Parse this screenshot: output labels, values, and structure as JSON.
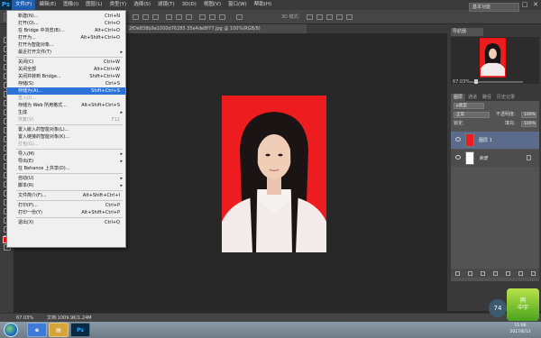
{
  "app": {
    "logo": "Ps"
  },
  "menubar": {
    "items": [
      "文件(F)",
      "编辑(E)",
      "图像(I)",
      "图层(L)",
      "类型(Y)",
      "选择(S)",
      "滤镜(T)",
      "3D(D)",
      "视图(V)",
      "窗口(W)",
      "帮助(H)"
    ],
    "active_index": 0
  },
  "window_controls": {
    "minimize": "–",
    "maximize": "□",
    "close": "✕"
  },
  "options_bar": {
    "label_3d": "3D 模式:",
    "workspace": "基本功能"
  },
  "document_tab": {
    "title": "2fDe838b9a1000d76285 35e4de8f77.jpg @ 100%(RGB/8)"
  },
  "file_menu": [
    {
      "label": "新建(N)...",
      "shortcut": "Ctrl+N"
    },
    {
      "label": "打开(O)...",
      "shortcut": "Ctrl+O"
    },
    {
      "label": "在 Bridge 中浏览(B)...",
      "shortcut": "Alt+Ctrl+O"
    },
    {
      "label": "打开为...",
      "shortcut": "Alt+Shift+Ctrl+O"
    },
    {
      "label": "打开为智能对象...",
      "shortcut": ""
    },
    {
      "label": "最近打开文件(T)",
      "shortcut": "",
      "submenu": true
    },
    {
      "sep": true
    },
    {
      "label": "关闭(C)",
      "shortcut": "Ctrl+W"
    },
    {
      "label": "关闭全部",
      "shortcut": "Alt+Ctrl+W"
    },
    {
      "label": "关闭并转到 Bridge...",
      "shortcut": "Shift+Ctrl+W"
    },
    {
      "label": "存储(S)",
      "shortcut": "Ctrl+S"
    },
    {
      "label": "存储为(A)...",
      "shortcut": "Shift+Ctrl+S",
      "highlight": true
    },
    {
      "label": "签入(I)...",
      "shortcut": "",
      "disabled": true
    },
    {
      "label": "存储为 Web 所用格式...",
      "shortcut": "Alt+Shift+Ctrl+S"
    },
    {
      "label": "生成",
      "shortcut": "",
      "submenu": true
    },
    {
      "label": "恢复(V)",
      "shortcut": "F12",
      "disabled": true
    },
    {
      "sep": true
    },
    {
      "label": "置入嵌入的智能对象(L)...",
      "shortcut": ""
    },
    {
      "label": "置入链接的智能对象(K)...",
      "shortcut": ""
    },
    {
      "label": "打包(G)...",
      "shortcut": "",
      "disabled": true
    },
    {
      "sep": true
    },
    {
      "label": "导入(M)",
      "shortcut": "",
      "submenu": true
    },
    {
      "label": "导出(E)",
      "shortcut": "",
      "submenu": true
    },
    {
      "label": "在 Behance 上共享(D)...",
      "shortcut": ""
    },
    {
      "sep": true
    },
    {
      "label": "自动(U)",
      "shortcut": "",
      "submenu": true
    },
    {
      "label": "脚本(R)",
      "shortcut": "",
      "submenu": true
    },
    {
      "sep": true
    },
    {
      "label": "文件简介(F)...",
      "shortcut": "Alt+Shift+Ctrl+I"
    },
    {
      "sep": true
    },
    {
      "label": "打印(P)...",
      "shortcut": "Ctrl+P"
    },
    {
      "label": "打印一份(Y)",
      "shortcut": "Alt+Shift+Ctrl+P"
    },
    {
      "sep": true
    },
    {
      "label": "退出(X)",
      "shortcut": "Ctrl+Q"
    }
  ],
  "navigator": {
    "tab": "导航器",
    "zoom": "67.03%"
  },
  "layers_panel": {
    "tabs": [
      "图层",
      "通道",
      "路径",
      "历史记录"
    ],
    "kind_filter": "ρ类型",
    "blend_mode": "正常",
    "opacity_label": "不透明度:",
    "opacity_value": "100%",
    "lock_label": "锁定:",
    "fill_label": "填充:",
    "fill_value": "100%",
    "layers": [
      {
        "name": "图层 1",
        "selected": true
      },
      {
        "name": "背景",
        "locked": true
      }
    ]
  },
  "status": {
    "zoom": "67.03%",
    "doc": "文档:1009.9K/1.24M"
  },
  "taskbar": {
    "ps_label": "Ps",
    "time": "11:06",
    "date": "2017/6/13"
  },
  "watermark": {
    "number": "74",
    "site": "网\n中宇"
  },
  "colors": {
    "accent": "#1c5fb3",
    "photo_bg": "#ed1c1f",
    "selected_layer": "#5a6b8c"
  }
}
